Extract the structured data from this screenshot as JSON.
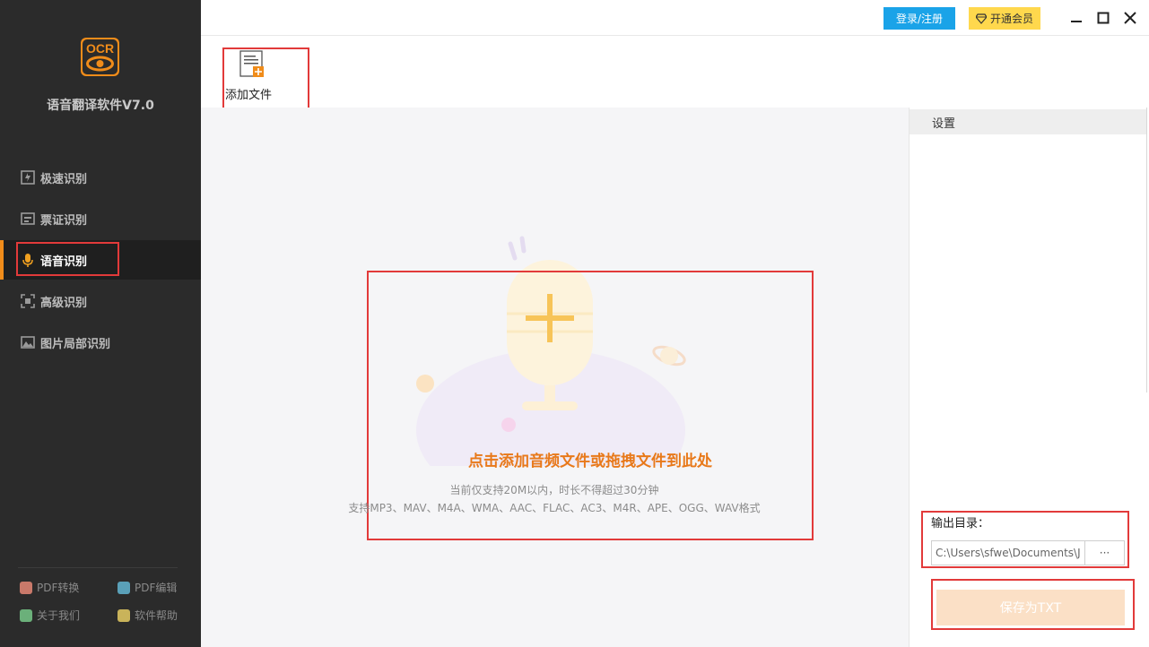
{
  "app": {
    "logo_text": "OCR",
    "title": "语音翻译软件V7.0"
  },
  "sidebar": {
    "items": [
      {
        "label": "极速识别",
        "icon": "fast-ocr-icon",
        "active": false
      },
      {
        "label": "票证识别",
        "icon": "ticket-icon",
        "active": false
      },
      {
        "label": "语音识别",
        "icon": "microphone-icon",
        "active": true
      },
      {
        "label": "高级识别",
        "icon": "advanced-scan-icon",
        "active": false
      },
      {
        "label": "图片局部识别",
        "icon": "image-region-icon",
        "active": false
      }
    ],
    "bottom_links": [
      {
        "label": "PDF转换",
        "icon": "pdf-convert-icon",
        "color": "#c9796a"
      },
      {
        "label": "PDF编辑",
        "icon": "pdf-edit-icon",
        "color": "#5aa0b8"
      },
      {
        "label": "关于我们",
        "icon": "about-icon",
        "color": "#6bb07a"
      },
      {
        "label": "软件帮助",
        "icon": "help-icon",
        "color": "#c9b35a"
      }
    ]
  },
  "topbar": {
    "login_label": "登录/注册",
    "vip_label": "开通会员"
  },
  "toolbar": {
    "add_file_label": "添加文件"
  },
  "main": {
    "drop_title": "点击添加音频文件或拖拽文件到此处",
    "note_limit": "当前仅支持20M以内，时长不得超过30分钟",
    "note_formats": "支持MP3、MAV、M4A、WMA、AAC、FLAC、AC3、M4R、APE、OGG、WAV格式"
  },
  "settings": {
    "header": "设置",
    "output_label": "输出目录：",
    "output_path": "C:\\Users\\sfwe\\Documents\\J",
    "browse_label": "···",
    "save_label": "保存为TXT"
  },
  "colors": {
    "accent": "#f08c1a",
    "login_bg": "#1aa3e8",
    "vip_bg": "#ffd84d",
    "highlight_border": "#e23a3a",
    "sidebar_bg": "#2b2b2b"
  }
}
